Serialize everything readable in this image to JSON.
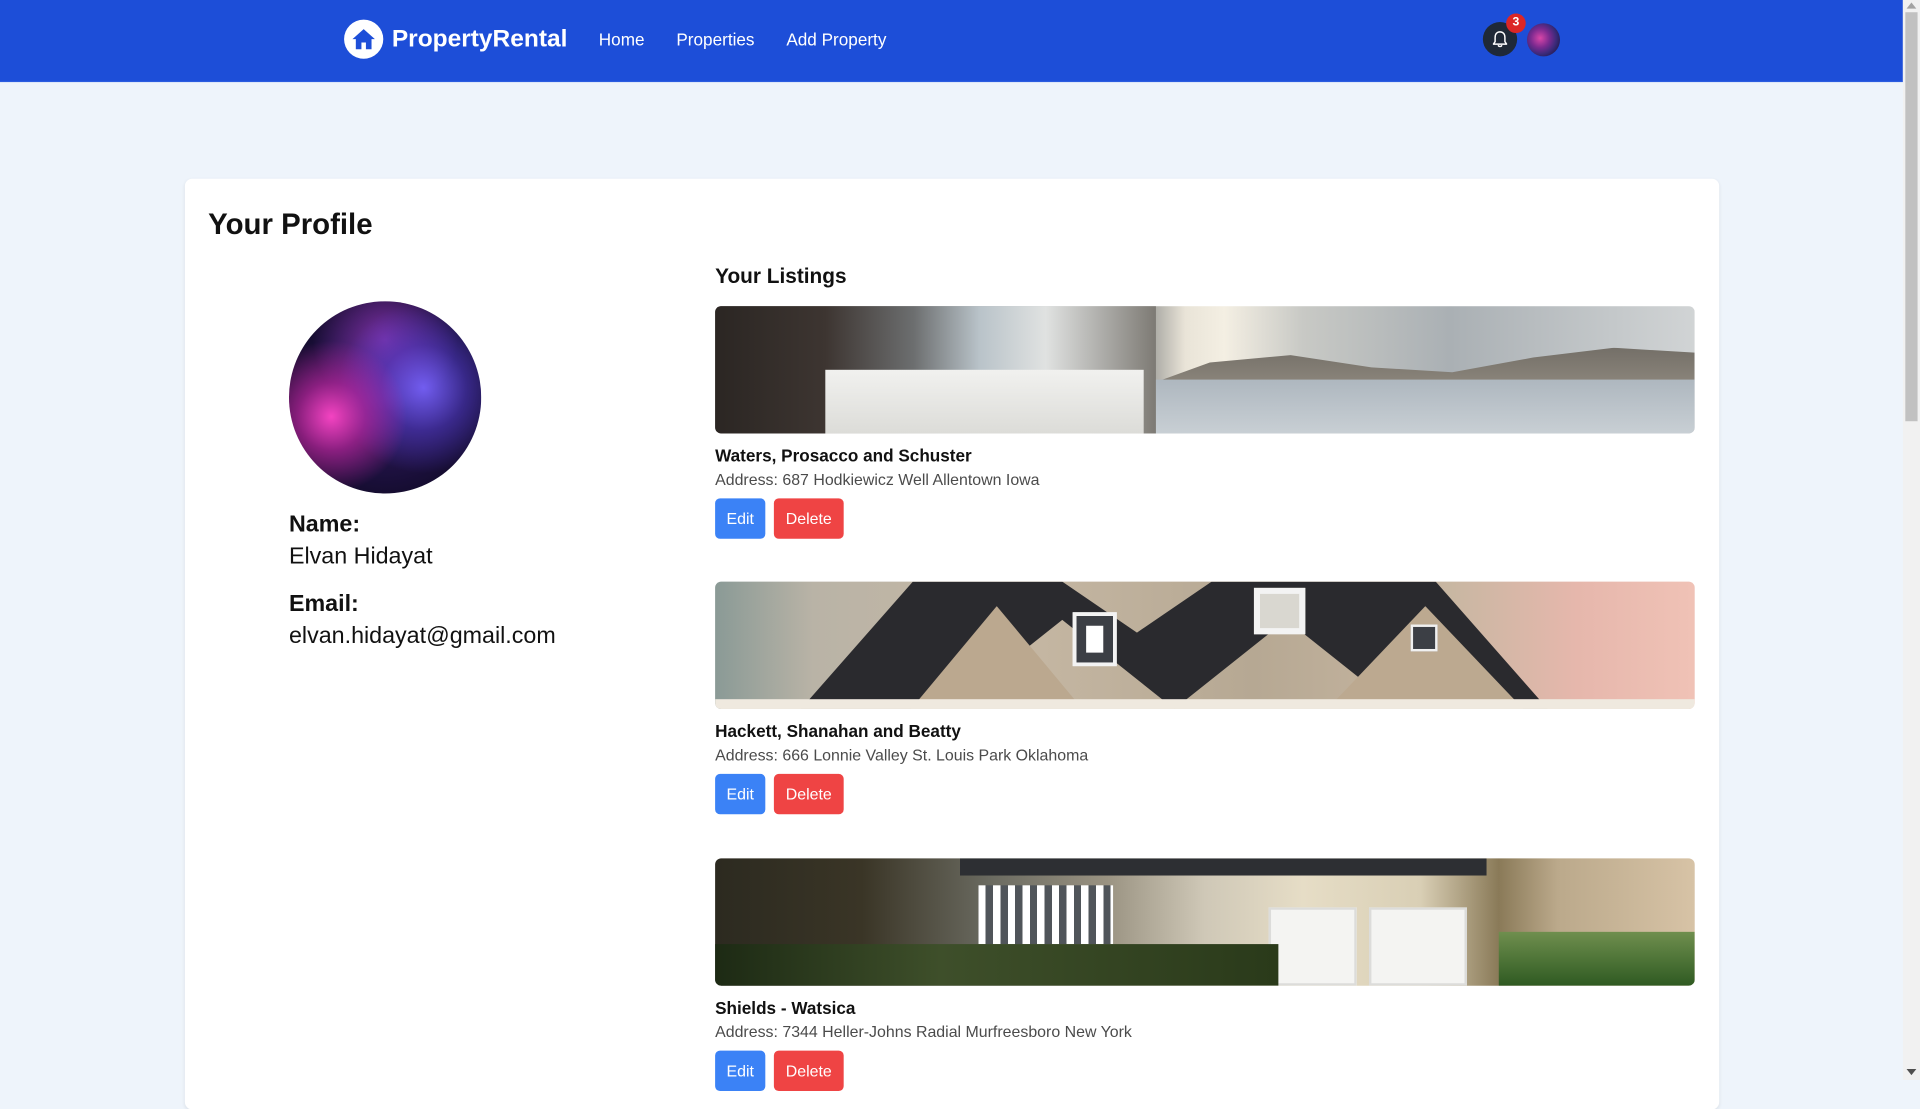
{
  "navbar": {
    "brand": "PropertyRental",
    "links": [
      "Home",
      "Properties",
      "Add Property"
    ],
    "notification_count": "3",
    "icons": {
      "logo": "home-icon",
      "bell": "bell-icon",
      "avatar": "user-avatar"
    },
    "colors": {
      "background": "#1d4ed8",
      "badge": "#dc2626"
    }
  },
  "profile": {
    "title": "Your Profile",
    "name_label": "Name:",
    "name_value": "Elvan Hidayat",
    "email_label": "Email:",
    "email_value": "elvan.hidayat@gmail.com"
  },
  "listings": {
    "title": "Your Listings",
    "edit_label": "Edit",
    "delete_label": "Delete",
    "items": [
      {
        "name": "Waters, Prosacco and Schuster",
        "address": "Address: 687 Hodkiewicz Well Allentown Iowa"
      },
      {
        "name": "Hackett, Shanahan and Beatty",
        "address": "Address: 666 Lonnie Valley St. Louis Park Oklahoma"
      },
      {
        "name": "Shields - Watsica",
        "address": "Address: 7344 Heller-Johns Radial Murfreesboro New York"
      }
    ],
    "colors": {
      "edit": "#3b82f6",
      "delete": "#ef4444"
    }
  }
}
